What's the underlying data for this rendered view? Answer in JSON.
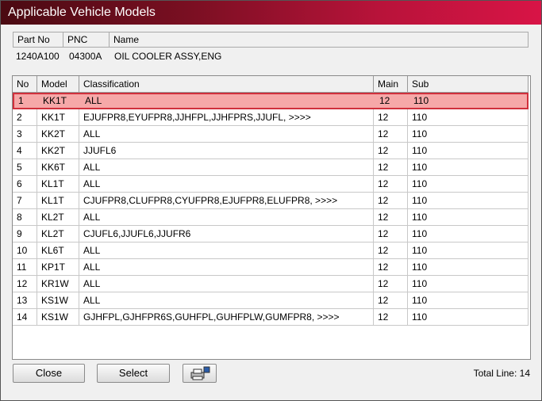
{
  "window": {
    "title": "Applicable Vehicle Models"
  },
  "part": {
    "headers": [
      "Part No",
      "PNC",
      "Name"
    ],
    "part_no": "1240A100",
    "pnc": "04300A",
    "name": "OIL COOLER ASSY,ENG"
  },
  "list": {
    "headers": [
      "No",
      "Model",
      "Classification",
      "Main",
      "Sub"
    ],
    "selected_index": 0,
    "rows": [
      {
        "no": "1",
        "model": "KK1T",
        "classification": "ALL",
        "main": "12",
        "sub": "110"
      },
      {
        "no": "2",
        "model": "KK1T",
        "classification": "EJUFPR8,EYUFPR8,JJHFPL,JJHFPRS,JJUFL,  >>>>",
        "main": "12",
        "sub": "110"
      },
      {
        "no": "3",
        "model": "KK2T",
        "classification": "ALL",
        "main": "12",
        "sub": "110"
      },
      {
        "no": "4",
        "model": "KK2T",
        "classification": "JJUFL6",
        "main": "12",
        "sub": "110"
      },
      {
        "no": "5",
        "model": "KK6T",
        "classification": "ALL",
        "main": "12",
        "sub": "110"
      },
      {
        "no": "6",
        "model": "KL1T",
        "classification": "ALL",
        "main": "12",
        "sub": "110"
      },
      {
        "no": "7",
        "model": "KL1T",
        "classification": "CJUFPR8,CLUFPR8,CYUFPR8,EJUFPR8,ELUFPR8,  >>>>",
        "main": "12",
        "sub": "110"
      },
      {
        "no": "8",
        "model": "KL2T",
        "classification": "ALL",
        "main": "12",
        "sub": "110"
      },
      {
        "no": "9",
        "model": "KL2T",
        "classification": "CJUFL6,JJUFL6,JJUFR6",
        "main": "12",
        "sub": "110"
      },
      {
        "no": "10",
        "model": "KL6T",
        "classification": "ALL",
        "main": "12",
        "sub": "110"
      },
      {
        "no": "11",
        "model": "KP1T",
        "classification": "ALL",
        "main": "12",
        "sub": "110"
      },
      {
        "no": "12",
        "model": "KR1W",
        "classification": "ALL",
        "main": "12",
        "sub": "110"
      },
      {
        "no": "13",
        "model": "KS1W",
        "classification": "ALL",
        "main": "12",
        "sub": "110"
      },
      {
        "no": "14",
        "model": "KS1W",
        "classification": "GJHFPL,GJHFPR6S,GUHFPL,GUHFPLW,GUMFPR8,  >>>>",
        "main": "12",
        "sub": "110"
      }
    ]
  },
  "buttons": {
    "close": "Close",
    "select": "Select",
    "print_icon": "printer-icon"
  },
  "status": {
    "total_line": "Total Line: 14"
  },
  "colors": {
    "title_start": "#4a0a12",
    "title_end": "#d81446",
    "selected_row": "#f6a8a8",
    "selected_border": "#d0303c"
  }
}
